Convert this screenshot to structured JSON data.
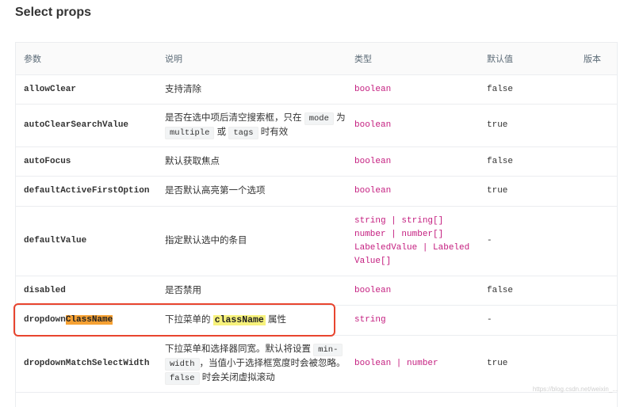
{
  "page": {
    "title": "Select props"
  },
  "table": {
    "headers": {
      "param": "参数",
      "desc": "说明",
      "type": "类型",
      "default": "默认值",
      "version": "版本"
    },
    "rows": {
      "allowClear": {
        "param": "allowClear",
        "desc": "支持清除",
        "type": "boolean",
        "default": "false"
      },
      "autoClearSearchValue": {
        "param": "autoClearSearchValue",
        "desc_a": "是否在选中项后清空搜索框，只在",
        "code_mode": "mode",
        "desc_b": "为",
        "code_multiple": "multiple",
        "desc_c": "或",
        "code_tags": "tags",
        "desc_d": "时有效",
        "type": "boolean",
        "default": "true"
      },
      "autoFocus": {
        "param": "autoFocus",
        "desc": "默认获取焦点",
        "type": "boolean",
        "default": "false"
      },
      "defaultActiveFirstOption": {
        "param": "defaultActiveFirstOption",
        "desc": "是否默认高亮第一个选项",
        "type": "boolean",
        "default": "true"
      },
      "defaultValue": {
        "param": "defaultValue",
        "desc": "指定默认选中的条目",
        "type_1": "string | string[]",
        "type_2": "number | number[]",
        "type_3": "LabeledValue | Labeled",
        "type_4": "Value[]",
        "default": "-"
      },
      "disabled": {
        "param": "disabled",
        "desc": "是否禁用",
        "type": "boolean",
        "default": "false"
      },
      "dropdownClassName": {
        "param_a": "dropdown",
        "param_b": "ClassName",
        "desc_a": "下拉菜单的",
        "code_className": "className",
        "desc_b": "属性",
        "type": "string",
        "default": "-"
      },
      "dropdownMatchSelectWidth": {
        "param": "dropdownMatchSelectWidth",
        "desc_a": "下拉菜单和选择器同宽。默认将设置",
        "code_minwidth_1": "min-",
        "code_minwidth_2": "width",
        "desc_b": "，当值小于选择框宽度时会被忽略。",
        "code_false": "false",
        "desc_c": "时会关闭虚拟滚动",
        "type": "boolean | number",
        "default": "true"
      }
    }
  },
  "watermark": "https://blog.csdn.net/weixin_...",
  "colors": {
    "type_text": "#c41d7f",
    "highlight_box": "#e8452f",
    "highlight_orange": "#f6a133",
    "highlight_yellow": "#f7f27c"
  }
}
